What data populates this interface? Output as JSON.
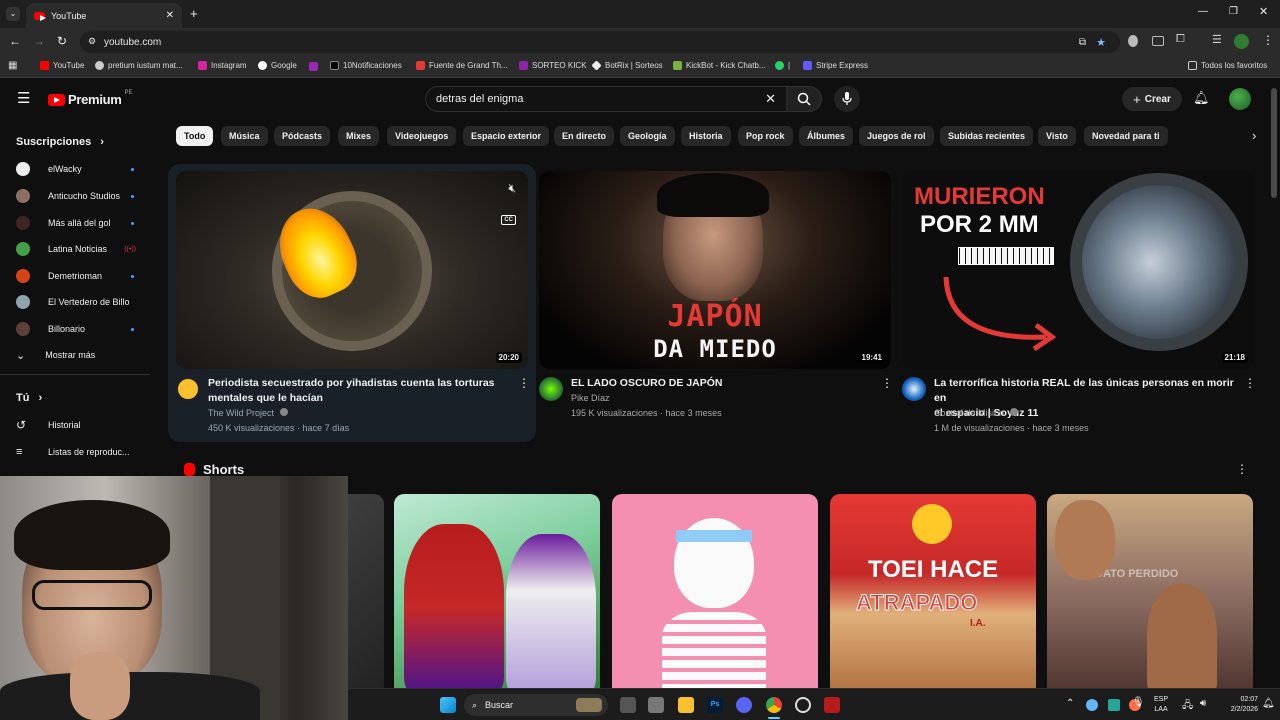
{
  "browser": {
    "tab_title": "YouTube",
    "url": "youtube.com",
    "bookmarks": [
      "YouTube",
      "pretium iustum mat...",
      "Instagram",
      "Google",
      "10Notificaciones",
      "Fuente de Grand Th...",
      "SORTEO KICK",
      "BotRix | Sorteos",
      "KickBot - Kick Chatb...",
      "|",
      "Stripe Express"
    ],
    "all_favorites": "Todos los favoritos"
  },
  "header": {
    "logo_text": "Premium",
    "logo_region": "PE",
    "search_value": "detras del enigma",
    "create_label": "Crear"
  },
  "sidebar": {
    "subscriptions_label": "Suscripciones",
    "subscriptions": [
      {
        "name": "elWacky"
      },
      {
        "name": "Anticucho Studios"
      },
      {
        "name": "Más allá del gol"
      },
      {
        "name": "Latina Noticias"
      },
      {
        "name": "Demetrioman"
      },
      {
        "name": "El Vertedero de Billo"
      },
      {
        "name": "Billonario"
      }
    ],
    "show_more": "Mostrar más",
    "you_label": "Tú",
    "history": "Historial",
    "playlists": "Listas de reproduc..."
  },
  "chips": [
    "Todo",
    "Música",
    "Pódcasts",
    "Mixes",
    "Videojuegos",
    "Espacio exterior",
    "En directo",
    "Geología",
    "Historia",
    "Pop rock",
    "Álbumes",
    "Juegos de rol",
    "Subidas recientes",
    "Visto",
    "Novedad para ti"
  ],
  "videos": [
    {
      "title_line1": "Periodista secuestrado por yihadistas cuenta las torturas",
      "title_line2": "mentales que le hacían",
      "channel": "The Wild Project",
      "meta": "450 K visualizaciones · hace 7 días",
      "duration": "20:20"
    },
    {
      "title_line1": "EL LADO OSCURO DE JAPÓN",
      "title_line2": "",
      "channel": "Pike Díaz",
      "meta": "195 K visualizaciones · hace 3 meses",
      "duration": "19:41",
      "thumb_text1": "JAPÓN",
      "thumb_text2": "DA MIEDO"
    },
    {
      "title_line1": "La terrorífica historia REAL de las únicas personas en morir en",
      "title_line2": "el espacio | Soyuz 11",
      "channel": "Control de Misión",
      "meta": "1 M de visualizaciones · hace 3 meses",
      "duration": "21:18",
      "thumb_text1": "MURIERON",
      "thumb_text2": "POR 2 MM"
    }
  ],
  "shorts": {
    "label": "Shorts",
    "short4_text1": "TOEI HACE",
    "short4_text2": "ATRAPADO",
    "short4_text3": "I.A.",
    "short5_text": "DATO PERDIDO"
  },
  "taskbar": {
    "search_label": "Buscar",
    "lang1": "ESP",
    "lang2": "LAA",
    "time": "02:07",
    "date": "2/2/2026"
  },
  "colors": {
    "background": "#0f0f0f",
    "accent_red": "#ff0000",
    "chip_bg": "#272727",
    "link_blue": "#3ea6ff"
  }
}
